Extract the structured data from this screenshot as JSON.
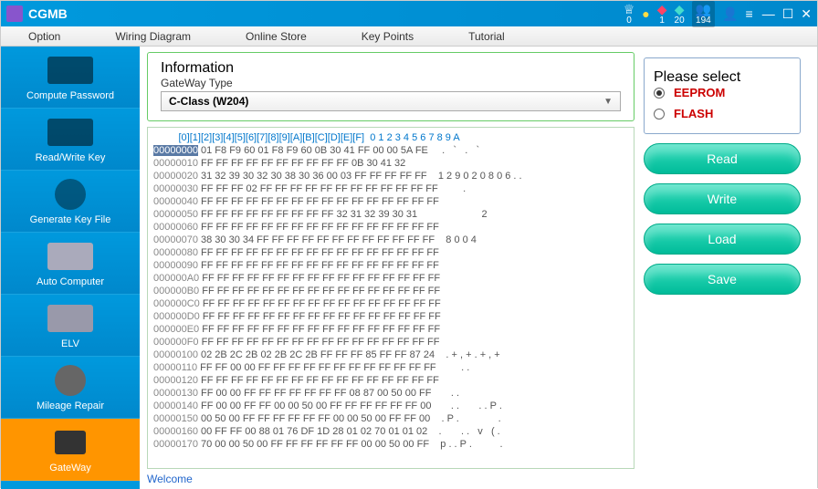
{
  "app": {
    "title": "CGMB"
  },
  "toolbar": {
    "crown_count": "0",
    "diamond_red_count": "1",
    "diamond_teal_count": "20",
    "users_count": "194"
  },
  "menu": {
    "option": "Option",
    "wiring": "Wiring Diagram",
    "online_store": "Online Store",
    "key_points": "Key Points",
    "tutorial": "Tutorial"
  },
  "sidebar": {
    "items": [
      {
        "label": "Compute Password"
      },
      {
        "label": "Read/Write Key"
      },
      {
        "label": "Generate Key File"
      },
      {
        "label": "Auto Computer"
      },
      {
        "label": "ELV"
      },
      {
        "label": "Mileage Repair"
      },
      {
        "label": "GateWay"
      }
    ]
  },
  "info": {
    "legend": "Information",
    "label": "GateWay Type",
    "selected": "C-Class  (W204)"
  },
  "hex": {
    "header_cols": "         [0][1][2][3][4][5][6][7][8][9][A][B][C][D][E][F]",
    "header_ascii": "  0 1 2 3 4 5 6 7 8 9 A",
    "rows": [
      {
        "addr": "00000000",
        "bytes": "01 F8 F9 60 01 F8 F9 60 0B 30 41 FF 00 00 5A FE",
        "ascii": "   .   `   .   `"
      },
      {
        "addr": "00000010",
        "bytes": "FF FF FF FF FF FF FF FF FF FF 0B 30 41 32",
        "ascii": "               "
      },
      {
        "addr": "00000020",
        "bytes": "31 32 39 30 32 30 38 30 36 00 03 FF FF FF FF FF",
        "ascii": "  1 2 9 0 2 0 8 0 6 . ."
      },
      {
        "addr": "00000030",
        "bytes": "FF FF FF 02 FF FF FF FF FF FF FF FF FF FF FF FF",
        "ascii": "       .               "
      },
      {
        "addr": "00000040",
        "bytes": "FF FF FF FF FF FF FF FF FF FF FF FF FF FF FF FF",
        "ascii": "                       "
      },
      {
        "addr": "00000050",
        "bytes": "FF FF FF FF FF FF FF FF FF 32 31 32 39 30 31",
        "ascii": "                     2"
      },
      {
        "addr": "00000060",
        "bytes": "FF FF FF FF FF FF FF FF FF FF FF FF FF FF FF FF",
        "ascii": "                       "
      },
      {
        "addr": "00000070",
        "bytes": "38 30 30 34 FF FF FF FF FF FF FF FF FF FF FF FF",
        "ascii": "  8 0 0 4              "
      },
      {
        "addr": "00000080",
        "bytes": "FF FF FF FF FF FF FF FF FF FF FF FF FF FF FF FF",
        "ascii": "                       "
      },
      {
        "addr": "00000090",
        "bytes": "FF FF FF FF FF FF FF FF FF FF FF FF FF FF FF FF",
        "ascii": "                       "
      },
      {
        "addr": "000000A0",
        "bytes": "FF FF FF FF FF FF FF FF FF FF FF FF FF FF FF FF",
        "ascii": "                       "
      },
      {
        "addr": "000000B0",
        "bytes": "FF FF FF FF FF FF FF FF FF FF FF FF FF FF FF FF",
        "ascii": "                       "
      },
      {
        "addr": "000000C0",
        "bytes": "FF FF FF FF FF FF FF FF FF FF FF FF FF FF FF FF",
        "ascii": "                       "
      },
      {
        "addr": "000000D0",
        "bytes": "FF FF FF FF FF FF FF FF FF FF FF FF FF FF FF FF",
        "ascii": "                       "
      },
      {
        "addr": "000000E0",
        "bytes": "FF FF FF FF FF FF FF FF FF FF FF FF FF FF FF FF",
        "ascii": "                       "
      },
      {
        "addr": "000000F0",
        "bytes": "FF FF FF FF FF FF FF FF FF FF FF FF FF FF FF FF",
        "ascii": "                       "
      },
      {
        "addr": "00000100",
        "bytes": "02 2B 2C 2B 02 2B 2C 2B FF FF FF 85 FF FF 87 24",
        "ascii": "  . + , + . + , + "
      },
      {
        "addr": "00000110",
        "bytes": "FF FF 00 00 FF FF FF FF FF FF FF FF FF FF FF FF",
        "ascii": "       . .             "
      },
      {
        "addr": "00000120",
        "bytes": "FF FF FF FF FF FF FF FF FF FF FF FF FF FF FF FF",
        "ascii": "                       "
      },
      {
        "addr": "00000130",
        "bytes": "FF 00 00 FF FF FF FF FF FF FF 08 87 00 50 00 FF",
        "ascii": "     . .               "
      },
      {
        "addr": "00000140",
        "bytes": "FF 00 00 FF FF 00 00 50 00 FF FF FF FF FF FF 00",
        "ascii": "     . .       . . P ."
      },
      {
        "addr": "00000150",
        "bytes": "00 50 00 FF FF FF FF FF FF 00 00 50 00 FF FF 00",
        "ascii": "  . P .              ."
      },
      {
        "addr": "00000160",
        "bytes": "00 FF FF 00 88 01 76 DF 1D 28 01 02 70 01 01 02",
        "ascii": "  .       . .   v   ( ."
      },
      {
        "addr": "00000170",
        "bytes": "70 00 00 50 00 FF FF FF FF FF FF 00 00 50 00 FF",
        "ascii": "  p . . P .          ."
      }
    ]
  },
  "welcome": "Welcome",
  "right": {
    "legend": "Please select",
    "eeprom": "EEPROM",
    "flash": "FLASH",
    "btn_read": "Read",
    "btn_write": "Write",
    "btn_load": "Load",
    "btn_save": "Save"
  }
}
